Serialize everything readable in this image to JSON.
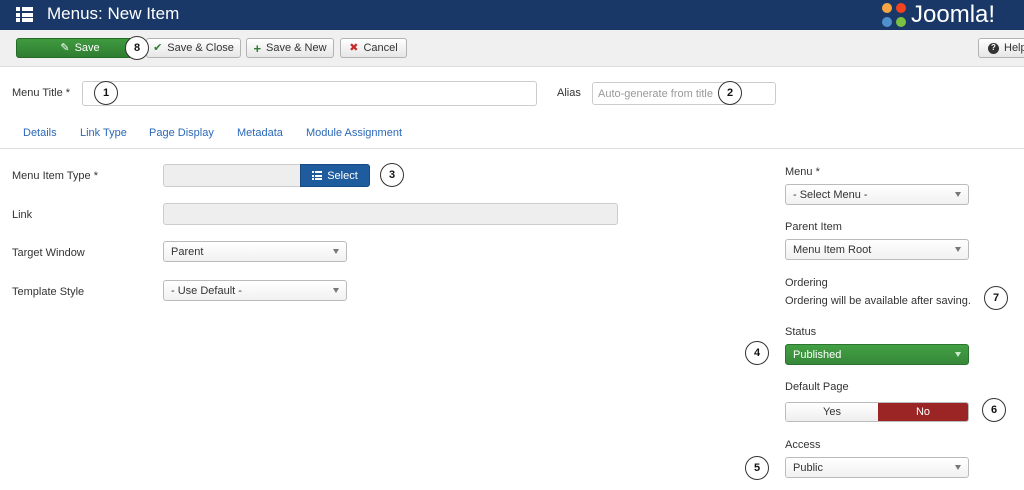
{
  "header": {
    "title": "Menus: New Item",
    "logo_text": "Joomla!"
  },
  "toolbar": {
    "save": "Save",
    "save_close": "Save & Close",
    "save_new": "Save & New",
    "cancel": "Cancel",
    "help": "Help"
  },
  "form": {
    "menu_title_label": "Menu Title *",
    "menu_title_value": "",
    "alias_label": "Alias",
    "alias_placeholder": "Auto-generate from title"
  },
  "tabs": [
    "Details",
    "Link Type",
    "Page Display",
    "Metadata",
    "Module Assignment"
  ],
  "details": {
    "item_type_label": "Menu Item Type *",
    "item_type_value": "",
    "select_button": "Select",
    "link_label": "Link",
    "link_value": "",
    "target_window_label": "Target Window",
    "target_window_value": "Parent",
    "template_style_label": "Template Style",
    "template_style_value": "- Use Default -"
  },
  "sidebar": {
    "menu_label": "Menu *",
    "menu_value": "- Select Menu -",
    "parent_label": "Parent Item",
    "parent_value": "Menu Item Root",
    "ordering_label": "Ordering",
    "ordering_note": "Ordering will be available after saving.",
    "status_label": "Status",
    "status_value": "Published",
    "default_page_label": "Default Page",
    "default_yes": "Yes",
    "default_no": "No",
    "access_label": "Access",
    "access_value": "Public"
  },
  "callouts": [
    "1",
    "2",
    "3",
    "4",
    "5",
    "6",
    "7",
    "8"
  ],
  "colors": {
    "header_bg": "#1a3867",
    "save_green": "#2f7d32",
    "select_blue": "#1f5c9d",
    "published_green": "#3a8d3a",
    "no_red": "#9b2424",
    "link_blue": "#2a69b8"
  }
}
